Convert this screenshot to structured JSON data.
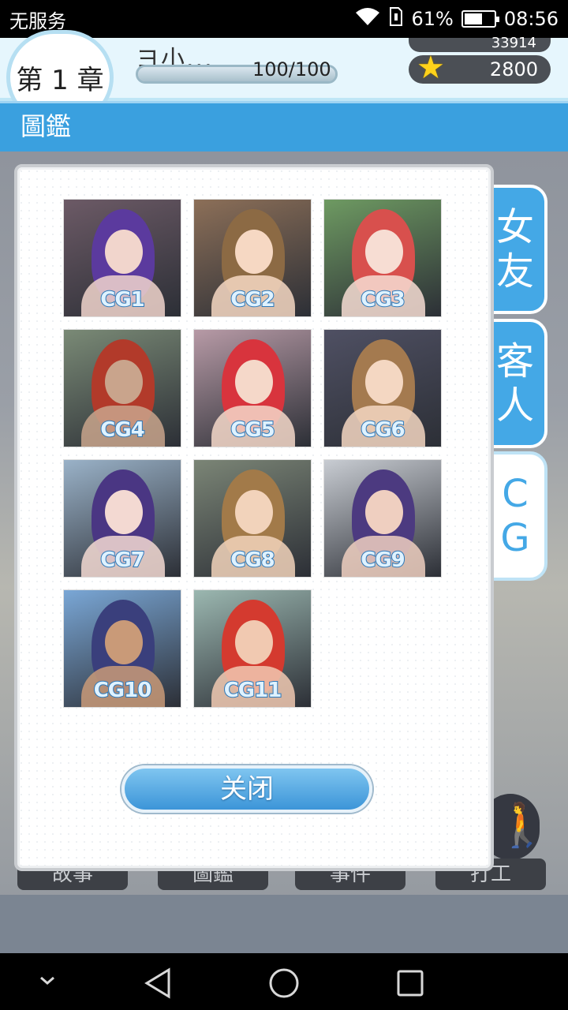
{
  "status_bar": {
    "carrier": "无服务",
    "battery": "61%",
    "battery_level": 0.61,
    "time": "08:56"
  },
  "hud": {
    "chapter": "第 1 章",
    "name": "ヨ小...",
    "hp": "100/100",
    "hp_level": 1.0,
    "coins": "33914",
    "stars": "2800"
  },
  "title": "圖鑑",
  "side_tabs": [
    {
      "label": "女\n友",
      "active": false
    },
    {
      "label": "客\n人",
      "active": false
    },
    {
      "label": "C\nG",
      "active": true
    }
  ],
  "gallery": {
    "items": [
      {
        "label": "CG1",
        "bg": "#6c5a66",
        "hair": "#5b3a9e",
        "skin": "#f1d5cc"
      },
      {
        "label": "CG2",
        "bg": "#8c6f58",
        "hair": "#8c6a44",
        "skin": "#f6d8c3"
      },
      {
        "label": "CG3",
        "bg": "#6e9a62",
        "hair": "#d8504d",
        "skin": "#f7ddd3"
      },
      {
        "label": "CG4",
        "bg": "#7a8a76",
        "hair": "#b23a2a",
        "skin": "#c9a48c"
      },
      {
        "label": "CG5",
        "bg": "#b79aa6",
        "hair": "#d8343d",
        "skin": "#f5d8c9"
      },
      {
        "label": "CG6",
        "bg": "#4f5063",
        "hair": "#a47a4f",
        "skin": "#f4d7c2"
      },
      {
        "label": "CG7",
        "bg": "#9ab2c8",
        "hair": "#4a3683",
        "skin": "#f3d9d2"
      },
      {
        "label": "CG8",
        "bg": "#7b8576",
        "hair": "#a27a49",
        "skin": "#f2d3bb"
      },
      {
        "label": "CG9",
        "bg": "#c8ccd2",
        "hair": "#4c3a80",
        "skin": "#efcfc0"
      },
      {
        "label": "CG10",
        "bg": "#7aa7d6",
        "hair": "#3a3f7c",
        "skin": "#c99a78"
      },
      {
        "label": "CG11",
        "bg": "#9bb7b0",
        "hair": "#d43a2f",
        "skin": "#f1c9b1"
      }
    ]
  },
  "close_button": "关闭",
  "bottom_buttons": [
    "故事",
    "圖鑑",
    "事件",
    "打工"
  ]
}
